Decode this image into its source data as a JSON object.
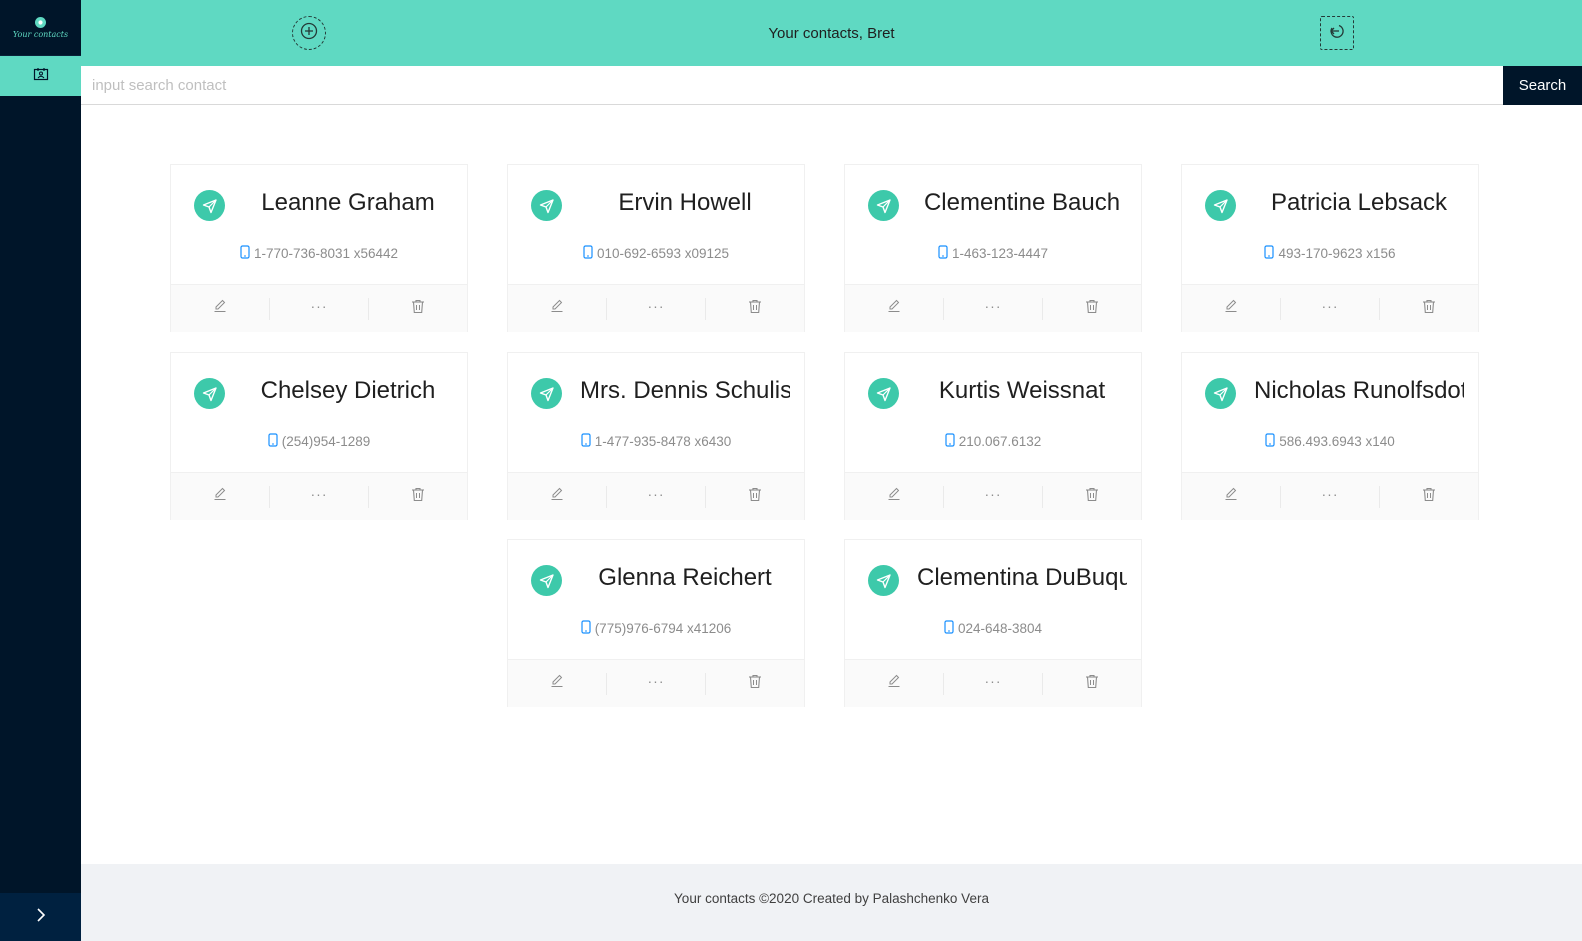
{
  "sidebar": {
    "logo_text": "Your contacts",
    "items": [
      {
        "icon": "contacts-icon"
      }
    ],
    "collapse_icon": "chevron-right-icon"
  },
  "header": {
    "title": "Your contacts, Bret",
    "add_icon": "plus-circle-icon",
    "logout_icon": "logout-icon"
  },
  "search": {
    "placeholder": "input search contact",
    "value": "",
    "button_label": "Search"
  },
  "contacts": [
    {
      "name": "Leanne Graham",
      "phone": "1-770-736-8031 x56442"
    },
    {
      "name": "Ervin Howell",
      "phone": "010-692-6593 x09125"
    },
    {
      "name": "Clementine Bauch",
      "phone": "1-463-123-4447"
    },
    {
      "name": "Patricia Lebsack",
      "phone": "493-170-9623 x156"
    },
    {
      "name": "Chelsey Dietrich",
      "phone": "(254)954-1289"
    },
    {
      "name": "Mrs. Dennis Schulist",
      "phone": "1-477-935-8478 x6430"
    },
    {
      "name": "Kurtis Weissnat",
      "phone": "210.067.6132"
    },
    {
      "name": "Nicholas Runolfsdottir V",
      "phone": "586.493.6943 x140"
    },
    {
      "name": "Glenna Reichert",
      "phone": "(775)976-6794 x41206"
    },
    {
      "name": "Clementina DuBuque",
      "phone": "024-648-3804"
    }
  ],
  "card_actions": {
    "edit_icon": "edit-icon",
    "more_label": "···",
    "delete_icon": "delete-icon"
  },
  "colors": {
    "primary": "#5fd9c2",
    "dark": "#001529",
    "avatar": "#3dc9aa",
    "phone_icon": "#1890ff"
  },
  "footer": {
    "text": "Your contacts ©2020 Created by Palashchenko Vera"
  }
}
